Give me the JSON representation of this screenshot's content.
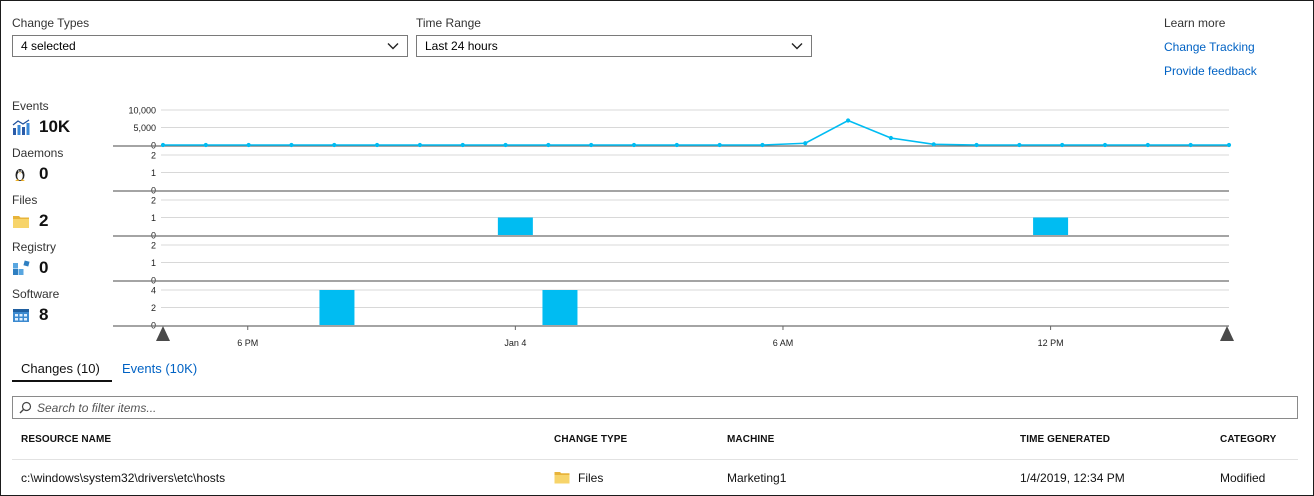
{
  "filters": {
    "change_types": {
      "label": "Change Types",
      "value": "4 selected"
    },
    "time_range": {
      "label": "Time Range",
      "value": "Last 24 hours"
    }
  },
  "learn_more": {
    "label": "Learn more",
    "links": [
      "Change Tracking",
      "Provide feedback"
    ]
  },
  "categories": [
    {
      "name": "Events",
      "count": "10K",
      "icon": "events-chart-icon"
    },
    {
      "name": "Daemons",
      "count": "0",
      "icon": "daemon-penguin-icon"
    },
    {
      "name": "Files",
      "count": "2",
      "icon": "folder-icon"
    },
    {
      "name": "Registry",
      "count": "0",
      "icon": "registry-blocks-icon"
    },
    {
      "name": "Software",
      "count": "8",
      "icon": "software-window-icon"
    }
  ],
  "chart_data": {
    "type": "line",
    "colors": {
      "series": "#00bcf2",
      "grid": "#d8d8d8",
      "separator": "#6d6d6d"
    },
    "x_ticks": [
      {
        "label": "6 PM",
        "t": 6
      },
      {
        "label": "Jan 4",
        "t": 12
      },
      {
        "label": "6 AM",
        "t": 18
      },
      {
        "label": "12 PM",
        "t": 24
      }
    ],
    "x_range": [
      4.1,
      28
    ],
    "panels": [
      {
        "name": "Events",
        "type": "line",
        "yticks": [
          "10,000",
          "5,000",
          "0"
        ],
        "ylim": [
          0,
          10000
        ],
        "points": [
          [
            4.1,
            0
          ],
          [
            5.06,
            0
          ],
          [
            6.02,
            0
          ],
          [
            6.98,
            0
          ],
          [
            7.94,
            0
          ],
          [
            8.9,
            0
          ],
          [
            9.86,
            0
          ],
          [
            10.82,
            0
          ],
          [
            11.78,
            0
          ],
          [
            12.74,
            0
          ],
          [
            13.7,
            0
          ],
          [
            14.66,
            0
          ],
          [
            15.62,
            0
          ],
          [
            16.58,
            0
          ],
          [
            17.54,
            0
          ],
          [
            18.5,
            500
          ],
          [
            19.46,
            7000
          ],
          [
            20.42,
            2000
          ],
          [
            21.38,
            200
          ],
          [
            22.34,
            0
          ],
          [
            23.3,
            0
          ],
          [
            24.26,
            0
          ],
          [
            25.22,
            0
          ],
          [
            26.18,
            0
          ],
          [
            27.14,
            0
          ],
          [
            28,
            0
          ]
        ]
      },
      {
        "name": "Daemons",
        "type": "bar",
        "yticks": [
          "2",
          "1",
          "0"
        ],
        "ylim": [
          0,
          2
        ],
        "bars": []
      },
      {
        "name": "Files",
        "type": "bar",
        "yticks": [
          "2",
          "1",
          "0"
        ],
        "ylim": [
          0,
          2
        ],
        "bars": [
          [
            12.0,
            1
          ],
          [
            24.0,
            1
          ]
        ]
      },
      {
        "name": "Registry",
        "type": "bar",
        "yticks": [
          "2",
          "1",
          "0"
        ],
        "ylim": [
          0,
          2
        ],
        "bars": []
      },
      {
        "name": "Software",
        "type": "bar",
        "yticks": [
          "4",
          "2",
          "0"
        ],
        "ylim": [
          0,
          4
        ],
        "bars": [
          [
            8.0,
            4
          ],
          [
            13.0,
            4
          ]
        ]
      }
    ]
  },
  "tabs": [
    {
      "label": "Changes (10)",
      "active": true
    },
    {
      "label": "Events (10K)",
      "active": false
    }
  ],
  "filter_box": {
    "placeholder": "Search to filter items..."
  },
  "table": {
    "columns": [
      "RESOURCE NAME",
      "CHANGE TYPE",
      "MACHINE",
      "TIME GENERATED",
      "CATEGORY"
    ],
    "rows": [
      {
        "resource": "c:\\windows\\system32\\drivers\\etc\\hosts",
        "change_type": "Files",
        "machine": "Marketing1",
        "time": "1/4/2019, 12:34 PM",
        "category": "Modified"
      }
    ]
  }
}
